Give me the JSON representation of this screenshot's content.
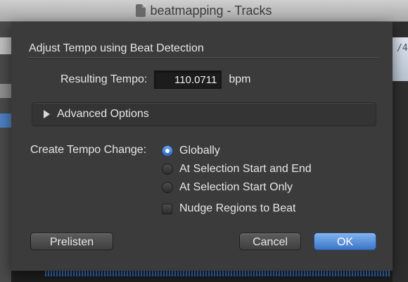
{
  "window": {
    "title": "beatmapping - Tracks",
    "lcd_text": "/4"
  },
  "dialog": {
    "title": "Adjust Tempo using Beat Detection",
    "resulting_tempo_label": "Resulting Tempo:",
    "resulting_tempo_value": "110.0711",
    "tempo_unit": "bpm",
    "advanced_options_label": "Advanced Options",
    "create_tempo_change_label": "Create Tempo Change:",
    "options": [
      {
        "label": "Globally",
        "selected": true
      },
      {
        "label": "At Selection Start and End",
        "selected": false
      },
      {
        "label": "At Selection Start Only",
        "selected": false
      }
    ],
    "nudge_label": "Nudge Regions to Beat",
    "nudge_checked": false,
    "buttons": {
      "prelisten": "Prelisten",
      "cancel": "Cancel",
      "ok": "OK"
    }
  },
  "colors": {
    "dialog_bg": "#3b3b3b",
    "accent": "#3d76c8"
  }
}
